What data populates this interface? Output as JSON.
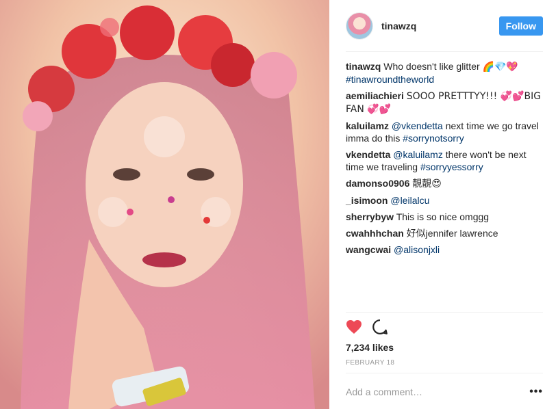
{
  "post": {
    "username": "tinawzq",
    "follow_label": "Follow",
    "caption": {
      "author": "tinawzq",
      "text": "Who doesn't like glitter",
      "emoji": "🌈💎💖",
      "hashtag": "#tinawroundtheworld"
    },
    "comments": [
      {
        "author": "aemiliachieri",
        "text": "SOOO PRETTTYY!!! 💞💕BIG FAN 💞💕"
      },
      {
        "author": "kaluilamz",
        "mention": "@vkendetta",
        "text": "next time we go travel imma do this",
        "hashtag": "#sorrynotsorry"
      },
      {
        "author": "vkendetta",
        "mention": "@kaluilamz",
        "text": "there won't be next time we traveling",
        "hashtag": "#sorryyessorry"
      },
      {
        "author": "damonso0906",
        "text": "靚靚😍"
      },
      {
        "author": "_isimoon",
        "mention": "@leilalcu"
      },
      {
        "author": "sherrybyw",
        "text": "This is so nice omggg"
      },
      {
        "author": "cwahhhchan",
        "text": "好似jennifer lawrence"
      },
      {
        "author": "wangcwai",
        "mention": "@alisonjxli"
      }
    ],
    "likes": "7,234 likes",
    "date": "FEBRUARY 18",
    "comment_placeholder": "Add a comment…",
    "more_label": "•••"
  },
  "colors": {
    "follow": "#3897f0",
    "heart": "#ed4956",
    "link": "#003569"
  },
  "icons": {
    "like": "heart-icon",
    "comment": "comment-bubble-icon",
    "more": "more-options-icon"
  }
}
